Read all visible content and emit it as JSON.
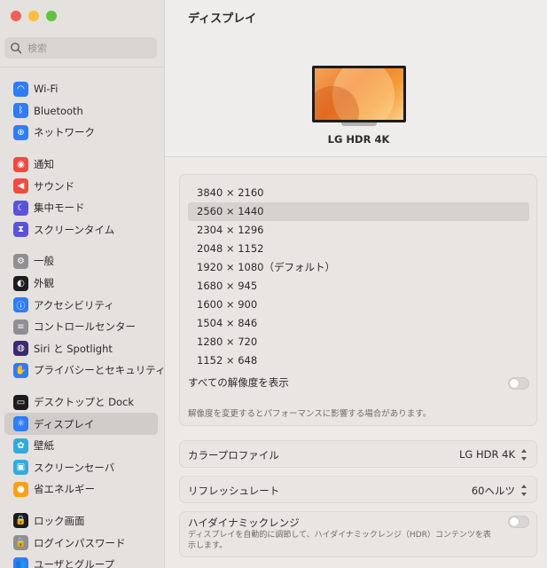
{
  "window": {
    "traffic_lights": [
      "#ee5f58",
      "#f8be3f",
      "#5fc43f"
    ]
  },
  "search": {
    "placeholder": "検索",
    "icon": "search-icon"
  },
  "sidebar": {
    "groups": [
      [
        {
          "label": "Wi-Fi",
          "icon": "wifi-icon",
          "color": "#2f7cf6",
          "glyph": "◠"
        },
        {
          "label": "Bluetooth",
          "icon": "bluetooth-icon",
          "color": "#2f7cf6",
          "glyph": "ᛒ"
        },
        {
          "label": "ネットワーク",
          "icon": "globe-icon",
          "color": "#2f7cf6",
          "glyph": "⊕"
        }
      ],
      [
        {
          "label": "通知",
          "icon": "bell-icon",
          "color": "#f04a41",
          "glyph": "◉"
        },
        {
          "label": "サウンド",
          "icon": "speaker-icon",
          "color": "#f04a41",
          "glyph": "◀"
        },
        {
          "label": "集中モード",
          "icon": "moon-icon",
          "color": "#5b53d6",
          "glyph": "☾"
        },
        {
          "label": "スクリーンタイム",
          "icon": "hourglass-icon",
          "color": "#5b53d6",
          "glyph": "⧗"
        }
      ],
      [
        {
          "label": "一般",
          "icon": "gear-icon",
          "color": "#8e8e93",
          "glyph": "⚙"
        },
        {
          "label": "外観",
          "icon": "appearance-icon",
          "color": "#1c1c1e",
          "glyph": "◐"
        },
        {
          "label": "アクセシビリティ",
          "icon": "accessibility-icon",
          "color": "#2f7cf6",
          "glyph": "ⓘ"
        },
        {
          "label": "コントロールセンター",
          "icon": "control-center-icon",
          "color": "#8e8e93",
          "glyph": "≡"
        },
        {
          "label": "Siri と Spotlight",
          "icon": "siri-icon",
          "color": "#3a2a6e",
          "glyph": "◍"
        },
        {
          "label": "プライバシーとセキュリティ",
          "icon": "hand-icon",
          "color": "#2f7cf6",
          "glyph": "✋"
        }
      ],
      [
        {
          "label": "デスクトップと Dock",
          "icon": "dock-icon",
          "color": "#1c1c1e",
          "glyph": "▭"
        },
        {
          "label": "ディスプレイ",
          "icon": "display-icon",
          "color": "#2f7cf6",
          "glyph": "☼",
          "selected": true
        },
        {
          "label": "壁紙",
          "icon": "wallpaper-icon",
          "color": "#34aadc",
          "glyph": "✿"
        },
        {
          "label": "スクリーンセーバ",
          "icon": "screensaver-icon",
          "color": "#34aadc",
          "glyph": "▣"
        },
        {
          "label": "省エネルギー",
          "icon": "bulb-icon",
          "color": "#f7a21b",
          "glyph": "●"
        }
      ],
      [
        {
          "label": "ロック画面",
          "icon": "lock-icon",
          "color": "#1c1c1e",
          "glyph": "🔒"
        },
        {
          "label": "ログインパスワード",
          "icon": "password-lock-icon",
          "color": "#8e8e93",
          "glyph": "🔒"
        },
        {
          "label": "ユーザとグループ",
          "icon": "users-icon",
          "color": "#2f7cf6",
          "glyph": "👥"
        }
      ]
    ]
  },
  "main": {
    "title": "ディスプレイ",
    "monitor_name": "LG HDR 4K",
    "resolutions": [
      {
        "label": "3840 × 2160",
        "selected": false
      },
      {
        "label": "2560 × 1440",
        "selected": true
      },
      {
        "label": "2304 × 1296",
        "selected": false
      },
      {
        "label": "2048 × 1152",
        "selected": false
      },
      {
        "label": "1920 × 1080（デフォルト）",
        "selected": false
      },
      {
        "label": "1680 × 945",
        "selected": false
      },
      {
        "label": "1600 × 900",
        "selected": false
      },
      {
        "label": "1504 × 846",
        "selected": false
      },
      {
        "label": "1280 × 720",
        "selected": false
      },
      {
        "label": "1152 × 648",
        "selected": false
      }
    ],
    "show_all_label": "すべての解像度を表示",
    "show_all_on": false,
    "resolution_hint": "解像度を変更するとパフォーマンスに影響する場合があります。",
    "color_profile": {
      "label": "カラープロファイル",
      "value": "LG HDR 4K"
    },
    "refresh_rate": {
      "label": "リフレッシュレート",
      "value": "60ヘルツ"
    },
    "hdr": {
      "label": "ハイダイナミックレンジ",
      "description": "ディスプレイを自動的に調節して、ハイダイナミックレンジ（HDR）コンテンツを表示します。",
      "on": false
    }
  }
}
